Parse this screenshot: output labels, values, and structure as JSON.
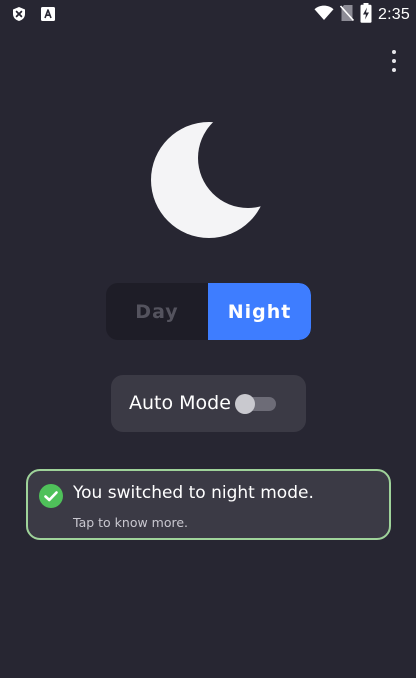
{
  "status_bar": {
    "time": "2:35",
    "left_icons": [
      "shield-x-icon",
      "font-a-icon"
    ],
    "right_icons": [
      "wifi-icon",
      "no-sim-icon",
      "battery-charging-icon"
    ]
  },
  "toolbar": {
    "menu_icon": "more-vert-icon"
  },
  "hero": {
    "icon": "moon-icon",
    "color": "#f4f4f6"
  },
  "mode_switch": {
    "options": [
      "Day",
      "Night"
    ],
    "selected": "Night",
    "accent_color": "#3e7dff"
  },
  "auto_mode": {
    "label": "Auto Mode",
    "enabled": false
  },
  "toast": {
    "title": "You switched to night mode.",
    "subtitle": "Tap to know more.",
    "icon": "check-circle-icon",
    "border_color": "#9fd39a",
    "icon_color": "#4fc15a"
  },
  "colors": {
    "background": "#272632",
    "card": "#3b3a45"
  }
}
